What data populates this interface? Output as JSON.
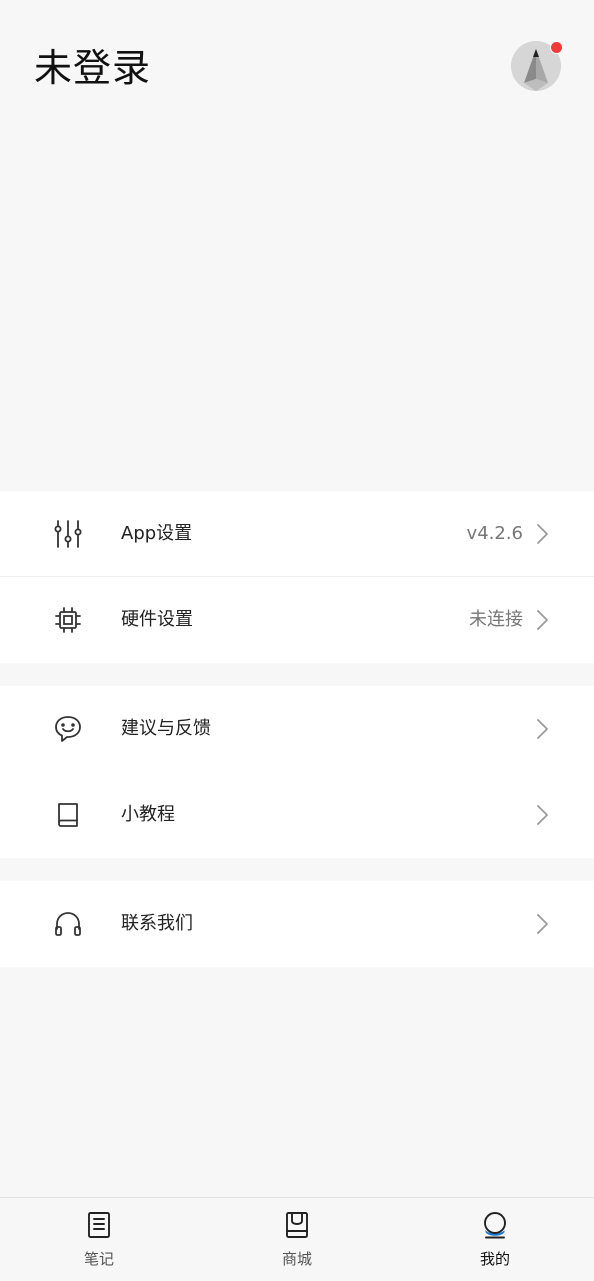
{
  "header": {
    "title": "未登录",
    "avatar_icon": "pencil-logo-icon",
    "has_notification": true,
    "notification_color": "#f23a3a"
  },
  "menu": {
    "group1": [
      {
        "icon": "sliders-icon",
        "label": "App设置",
        "value": "v4.2.6"
      },
      {
        "icon": "chip-icon",
        "label": "硬件设置",
        "value": "未连接"
      }
    ],
    "group2": [
      {
        "icon": "chat-smile-icon",
        "label": "建议与反馈",
        "value": ""
      },
      {
        "icon": "book-icon",
        "label": "小教程",
        "value": ""
      }
    ],
    "group3": [
      {
        "icon": "headphones-icon",
        "label": "联系我们",
        "value": ""
      }
    ]
  },
  "tabbar": {
    "tabs": [
      {
        "icon": "notes-icon",
        "label": "笔记",
        "active": false
      },
      {
        "icon": "shop-bag-icon",
        "label": "商城",
        "active": false
      },
      {
        "icon": "profile-icon",
        "label": "我的",
        "active": true
      }
    ],
    "accent_color": "#1f78d1"
  }
}
